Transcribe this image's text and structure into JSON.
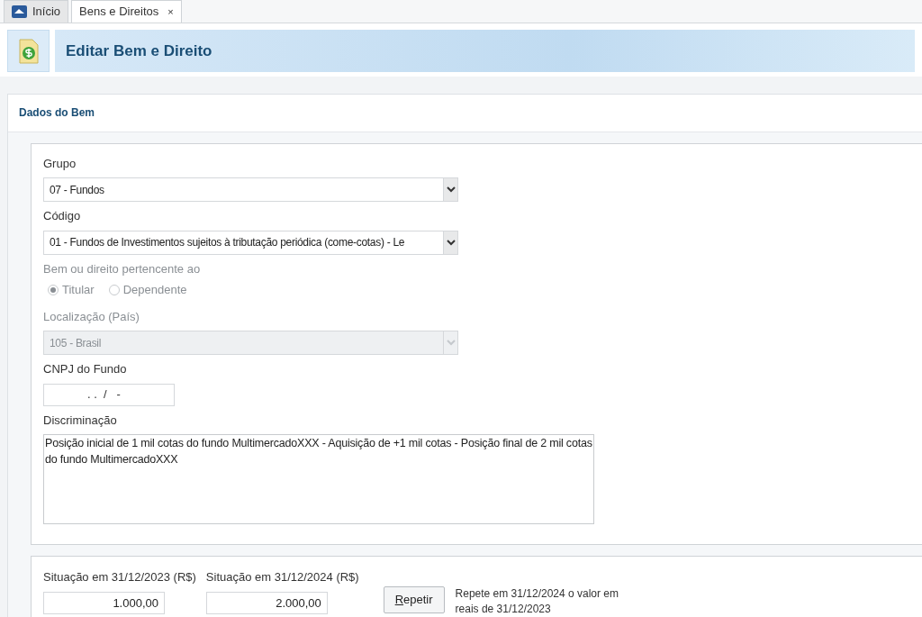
{
  "tabs": [
    {
      "label": "Início",
      "selected": false,
      "closable": false
    },
    {
      "label": "Bens e Direitos",
      "selected": true,
      "closable": true
    }
  ],
  "close_glyph": "×",
  "header": {
    "title": "Editar Bem e Direito"
  },
  "section": {
    "title": "Dados do Bem"
  },
  "fields": [
    {
      "kind": "select",
      "label": "Grupo",
      "value": "07 - Fundos",
      "disabled": false
    },
    {
      "kind": "select",
      "label": "Código",
      "value": "01 - Fundos de Investimentos sujeitos à tributação periódica (come-cotas) - Le",
      "disabled": false
    },
    {
      "kind": "radio",
      "label": "Bem ou direito pertencente ao",
      "disabled": true,
      "options": [
        {
          "label": "Titular",
          "selected": true
        },
        {
          "label": "Dependente",
          "selected": false
        }
      ]
    },
    {
      "kind": "select",
      "label": "Localização (País)",
      "value": "105 - Brasil",
      "disabled": true
    },
    {
      "kind": "masked",
      "label": "CNPJ do Fundo",
      "value": ". .  /   -"
    },
    {
      "kind": "textarea",
      "label": "Discriminação",
      "value": "Posição inicial de 1 mil cotas do fundo MultimercadoXXX - Aquisição de +1 mil cotas - Posição final de 2 mil cotas do fundo MultimercadoXXX"
    }
  ],
  "values": [
    {
      "label": "Situação em 31/12/2023 (R$)",
      "value": "1.000,00"
    },
    {
      "label": "Situação em 31/12/2024 (R$)",
      "value": "2.000,00"
    }
  ],
  "repeat": {
    "button": "Repetir",
    "hint": "Repete em 31/12/2024 o valor em reais de 31/12/2023"
  }
}
